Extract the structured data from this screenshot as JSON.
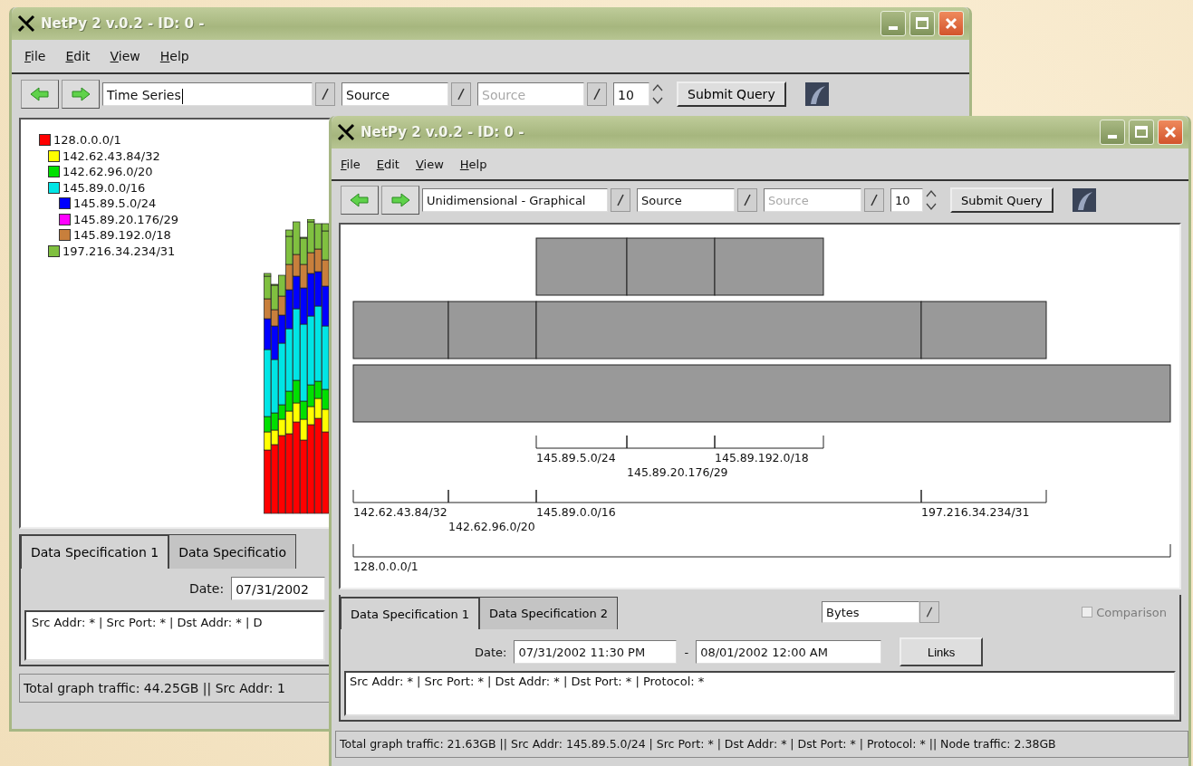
{
  "back_window": {
    "title": "NetPy 2 v.0.2 - ID: 0 -",
    "menu": [
      "File",
      "Edit",
      "View",
      "Help"
    ],
    "toolbar": {
      "view": "Time Series",
      "source": "Source",
      "source_2": {
        "value": "Source",
        "disabled": true
      },
      "count": "10",
      "submit": "Submit Query"
    },
    "legend": [
      {
        "label": "128.0.0.0/1",
        "color": "#ff0000",
        "children": [
          {
            "label": "142.62.43.84/32",
            "color": "#ffff00"
          },
          {
            "label": "142.62.96.0/20",
            "color": "#00e000"
          },
          {
            "label": "145.89.0.0/16",
            "color": "#00e5e5",
            "children": [
              {
                "label": "145.89.5.0/24",
                "color": "#0000ff"
              },
              {
                "label": "145.89.20.176/29",
                "color": "#ff00ff"
              },
              {
                "label": "145.89.192.0/18",
                "color": "#c87f3c"
              }
            ]
          },
          {
            "label": "197.216.34.234/31",
            "color": "#80c040"
          }
        ]
      }
    ],
    "tabs": [
      {
        "label": "Data Specification 1",
        "selected": true
      },
      {
        "label": "Data Specificatio",
        "selected": false
      }
    ],
    "date_label": "Date:",
    "date_from": "07/31/2002",
    "query": "Src Addr: * | Src Port: * | Dst Addr: * | D",
    "status_bar": "Total graph traffic: 44.25GB || Src Addr: 1"
  },
  "front_window": {
    "title": "NetPy 2 v.0.2 - ID: 0 -",
    "menu": [
      "File",
      "Edit",
      "View",
      "Help"
    ],
    "toolbar": {
      "view": "Unidimensional - Graphical",
      "source": "Source",
      "source_2": {
        "value": "Source",
        "disabled": true
      },
      "count": "10",
      "submit": "Submit Query"
    },
    "address_tree": [
      {
        "label": "128.0.0.0/1",
        "children": [
          {
            "label": "142.62.43.84/32"
          },
          {
            "label": "142.62.96.0/20"
          },
          {
            "label": "145.89.0.0/16",
            "children": [
              {
                "label": "145.89.5.0/24"
              },
              {
                "label": "145.89.20.176/29"
              },
              {
                "label": "145.89.192.0/18"
              }
            ]
          },
          {
            "label": "197.216.34.234/31"
          }
        ]
      }
    ],
    "tabs": [
      {
        "label": "Data Specification 1",
        "selected": true
      },
      {
        "label": "Data Specification 2",
        "selected": false
      }
    ],
    "unit": "Bytes",
    "comparison": {
      "label": "Comparison",
      "checked": false,
      "disabled": true
    },
    "date_label": "Date:",
    "date_from": "07/31/2002 11:30 PM",
    "separator": "-",
    "date_to": "08/01/2002 12:00 AM",
    "links": "Links",
    "query": "Src Addr: * | Src Port: * | Dst Addr: * | Dst Port: * | Protocol: *",
    "status_bar": "Total graph traffic: 21.63GB || Src Addr: 145.89.5.0/24 | Src Port: * | Dst Addr: * | Dst Port: * | Protocol: * || Node traffic: 2.38GB"
  }
}
